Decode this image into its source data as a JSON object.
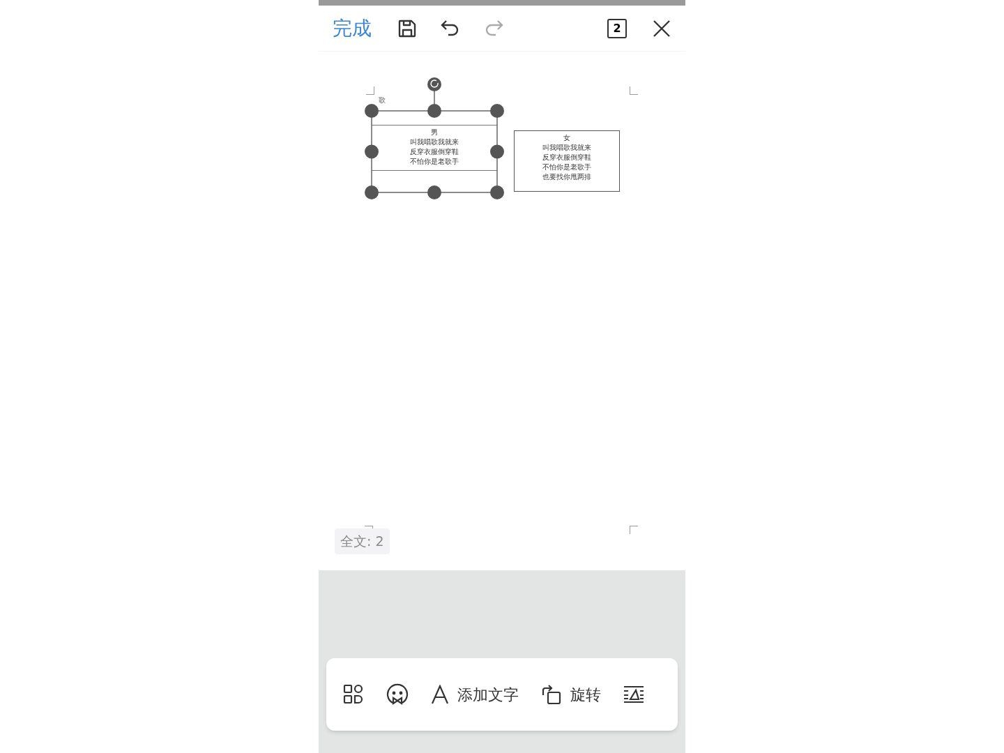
{
  "top_bar": {
    "done": "完成",
    "page_count": "2",
    "redo_disabled": true
  },
  "document": {
    "caption": "歌",
    "text_boxes": [
      {
        "lines": [
          "男",
          "叫我唱歌我就来",
          "反穿衣服倒穿鞋",
          "不怕你是老歌手"
        ],
        "selected": true
      },
      {
        "lines": [
          "女",
          "叫我唱歌我就来",
          "反穿衣服倒穿鞋",
          "不怕你是老歌手",
          "也要找你甩两排"
        ],
        "selected": false
      }
    ]
  },
  "word_count": "全文: 2",
  "bottom_toolbar": [
    {
      "kind": "grid"
    },
    {
      "kind": "face"
    },
    {
      "kind": "text",
      "label": "添加文字"
    },
    {
      "kind": "rotate",
      "label": "旋转"
    },
    {
      "kind": "wrap"
    }
  ]
}
